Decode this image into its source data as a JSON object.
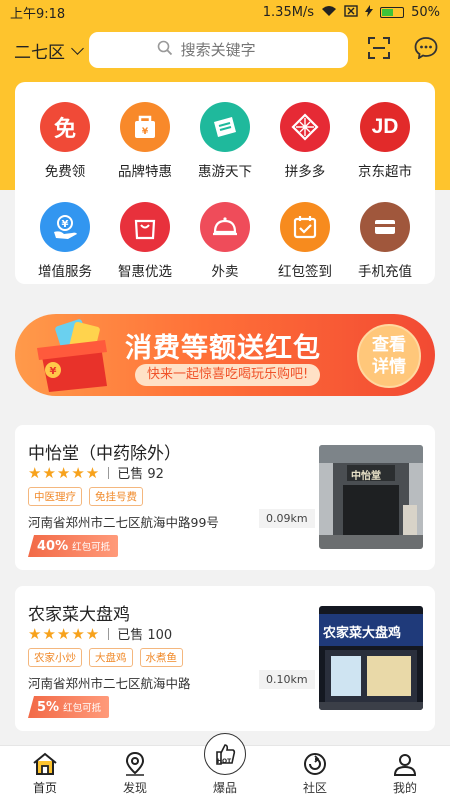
{
  "status_bar": {
    "time": "上午9:18",
    "network_speed": "1.35M/s",
    "battery": "50%",
    "battery_level": 0.5
  },
  "header": {
    "district": "二七区",
    "search_placeholder": "搜索关键字"
  },
  "categories": [
    {
      "label": "免费领",
      "icon": "free-icon",
      "color": "#f04a37",
      "glyph": "免"
    },
    {
      "label": "品牌特惠",
      "icon": "brand-bag-icon",
      "color": "#f8892a",
      "glyph": ""
    },
    {
      "label": "惠游天下",
      "icon": "ticket-icon",
      "color": "#1fb99c",
      "glyph": ""
    },
    {
      "label": "拼多多",
      "icon": "pinduoduo-icon",
      "color": "#e62a35",
      "glyph": ""
    },
    {
      "label": "京东超市",
      "icon": "jd-icon",
      "color": "#e22a2a",
      "glyph": "JD"
    },
    {
      "label": "增值服务",
      "icon": "money-hand-icon",
      "color": "#3296f0",
      "glyph": ""
    },
    {
      "label": "智惠优选",
      "icon": "shopping-bag-icon",
      "color": "#e8313c",
      "glyph": ""
    },
    {
      "label": "外卖",
      "icon": "food-cloche-icon",
      "color": "#ef4c5a",
      "glyph": ""
    },
    {
      "label": "红包签到",
      "icon": "calendar-check-icon",
      "color": "#f78b1e",
      "glyph": ""
    },
    {
      "label": "手机充值",
      "icon": "card-icon",
      "color": "#a0573c",
      "glyph": ""
    }
  ],
  "banner": {
    "title": "消费等额送红包",
    "subtitle": "快来一起惊喜吃喝玩乐购吧!",
    "button_line1": "查看",
    "button_line2": "详情"
  },
  "shops": [
    {
      "name": "中怡堂（中药除外）",
      "rating": 5,
      "stars": "★★★★★",
      "sold": "已售 92",
      "tags": [
        "中医理疗",
        "免挂号费"
      ],
      "address": "河南省郑州市二七区航海中路99号",
      "distance": "0.09km",
      "redpack_pct": "40%",
      "redpack_text": "红包可抵",
      "sign_text": "中怡堂"
    },
    {
      "name": "农家菜大盘鸡",
      "rating": 5,
      "stars": "★★★★★",
      "sold": "已售 100",
      "tags": [
        "农家小炒",
        "大盘鸡",
        "水煮鱼"
      ],
      "address": "河南省郑州市二七区航海中路",
      "distance": "0.10km",
      "redpack_pct": "5%",
      "redpack_text": "红包可抵",
      "sign_text": "农家菜大盘鸡"
    }
  ],
  "tabbar": {
    "home": "首页",
    "discover": "发现",
    "hot": "爆品",
    "hot_badge": "HOT",
    "community": "社区",
    "mine": "我的"
  }
}
